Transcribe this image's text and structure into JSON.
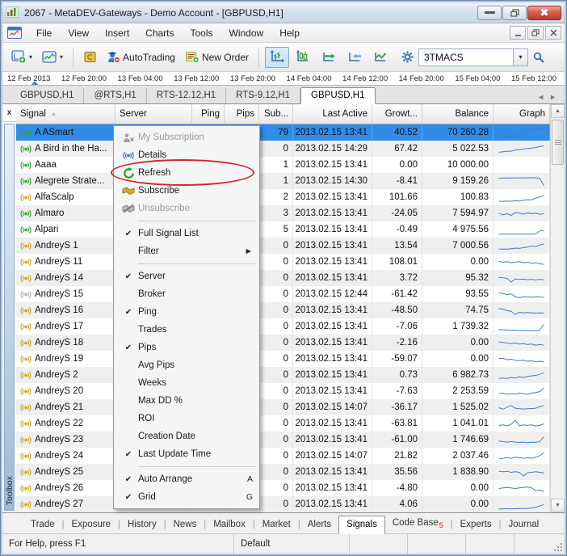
{
  "colors": {
    "selected_row": "#2f8ce8",
    "sparkline": "#3a7dc9",
    "annotation": "#d0262c",
    "signal_green": "#2da52d",
    "signal_yellow": "#d4a800",
    "signal_gray": "#b0b0b0"
  },
  "window": {
    "title": "2067 - MetaDEV-Gateways - Demo Account - [GBPUSD,H1]"
  },
  "menu_bar": {
    "items": [
      "File",
      "View",
      "Insert",
      "Charts",
      "Tools",
      "Window",
      "Help"
    ]
  },
  "toolbar": {
    "autotrading_label": "AutoTrading",
    "new_order_label": "New Order",
    "symbol_box_value": "3TMACS"
  },
  "timeline": {
    "labels": [
      "12 Feb 2013",
      "12 Feb 20:00",
      "13 Feb 04:00",
      "13 Feb 12:00",
      "13 Feb 20:00",
      "14 Feb 04:00",
      "14 Feb 12:00",
      "14 Feb 20:00",
      "15 Feb 04:00",
      "15 Feb 12:00"
    ]
  },
  "chart_tabs": {
    "tabs": [
      {
        "label": "GBPUSD,H1",
        "active": false
      },
      {
        "label": "@RTS,H1",
        "active": false
      },
      {
        "label": "RTS-12.12,H1",
        "active": false
      },
      {
        "label": "RTS-9.12,H1",
        "active": false
      },
      {
        "label": "GBPUSD,H1",
        "active": true
      }
    ]
  },
  "signals_table": {
    "columns": [
      {
        "key": "signal",
        "label": "Signal",
        "align": "left",
        "sorted": true
      },
      {
        "key": "server",
        "label": "Server",
        "align": "left"
      },
      {
        "key": "ping",
        "label": "Ping",
        "align": "right"
      },
      {
        "key": "pips",
        "label": "Pips",
        "align": "right"
      },
      {
        "key": "sub",
        "label": "Sub...",
        "align": "right"
      },
      {
        "key": "last_active",
        "label": "Last Active",
        "align": "right"
      },
      {
        "key": "growth",
        "label": "Growt...",
        "align": "right"
      },
      {
        "key": "balance",
        "label": "Balance",
        "align": "right"
      },
      {
        "key": "graph",
        "label": "Graph",
        "align": "right"
      }
    ],
    "selected_index": 0,
    "rows": [
      {
        "signal": "A ASmart",
        "icon": "green",
        "sub": "79",
        "last_active": "2013.02.15 13:41",
        "growth": "40.52",
        "balance": "70 260.28",
        "spark": [
          0.1,
          0.1,
          0.12,
          0.15,
          0.2,
          0.3,
          0.45,
          0.6,
          0.75,
          0.85,
          0.9,
          0.92
        ]
      },
      {
        "signal": "A Bird in the Ha...",
        "icon": "green",
        "sub": "0",
        "last_active": "2013.02.15 14:29",
        "growth": "67.42",
        "balance": "5 022.53",
        "spark": [
          0.2,
          0.25,
          0.3,
          0.3,
          0.4,
          0.45,
          0.5,
          0.55,
          0.6,
          0.65,
          0.75,
          0.8
        ]
      },
      {
        "signal": "Aaaa",
        "icon": "green",
        "sub": "1",
        "last_active": "2013.02.15 13:41",
        "growth": "0.00",
        "balance": "10 000.00",
        "spark": null
      },
      {
        "signal": "Alegrete Strate...",
        "icon": "green",
        "sub": "1",
        "last_active": "2013.02.15 14:30",
        "growth": "-8.41",
        "balance": "9 159.26",
        "spark": [
          0.8,
          0.82,
          0.82,
          0.83,
          0.83,
          0.84,
          0.84,
          0.85,
          0.85,
          0.85,
          0.8,
          0.1
        ]
      },
      {
        "signal": "AlfaScalp",
        "icon": "yellow",
        "sub": "2",
        "last_active": "2013.02.15 13:41",
        "growth": "101.66",
        "balance": "100.83",
        "spark": [
          0.15,
          0.15,
          0.18,
          0.15,
          0.2,
          0.18,
          0.25,
          0.3,
          0.28,
          0.45,
          0.55,
          0.7
        ]
      },
      {
        "signal": "Almaro",
        "icon": "green",
        "sub": "3",
        "last_active": "2013.02.15 13:41",
        "growth": "-24.05",
        "balance": "7 594.97",
        "spark": [
          0.55,
          0.4,
          0.5,
          0.35,
          0.6,
          0.55,
          0.45,
          0.6,
          0.5,
          0.55,
          0.45,
          0.5
        ]
      },
      {
        "signal": "Alpari",
        "icon": "green",
        "sub": "5",
        "last_active": "2013.02.15 13:41",
        "growth": "-0.49",
        "balance": "4 975.56",
        "spark": [
          0.1,
          0.1,
          0.1,
          0.1,
          0.1,
          0.1,
          0.1,
          0.1,
          0.1,
          0.12,
          0.4,
          0.45
        ]
      },
      {
        "signal": "AndreyS 1",
        "icon": "yellow",
        "sub": "0",
        "last_active": "2013.02.15 13:41",
        "growth": "13.54",
        "balance": "7 000.56",
        "spark": [
          0.2,
          0.22,
          0.2,
          0.25,
          0.3,
          0.28,
          0.35,
          0.4,
          0.5,
          0.45,
          0.6,
          0.7
        ]
      },
      {
        "signal": "AndreyS 11",
        "icon": "yellow",
        "sub": "0",
        "last_active": "2013.02.15 13:41",
        "growth": "108.01",
        "balance": "0.00",
        "spark": [
          0.6,
          0.5,
          0.55,
          0.45,
          0.5,
          0.55,
          0.45,
          0.5,
          0.4,
          0.45,
          0.35,
          0.3
        ]
      },
      {
        "signal": "AndreyS 14",
        "icon": "yellow",
        "sub": "0",
        "last_active": "2013.02.15 13:41",
        "growth": "3.72",
        "balance": "95.32",
        "spark": [
          0.6,
          0.55,
          0.5,
          0.15,
          0.45,
          0.4,
          0.42,
          0.38,
          0.4,
          0.35,
          0.4,
          0.38
        ]
      },
      {
        "signal": "AndreyS 15",
        "icon": "gray",
        "sub": "0",
        "last_active": "2013.02.15 12:44",
        "growth": "-61.42",
        "balance": "93.55",
        "spark": [
          0.7,
          0.6,
          0.5,
          0.55,
          0.3,
          0.2,
          0.3,
          0.28,
          0.25,
          0.3,
          0.28,
          0.25
        ]
      },
      {
        "signal": "AndreyS 16",
        "icon": "yellow",
        "sub": "0",
        "last_active": "2013.02.15 13:41",
        "growth": "-48.50",
        "balance": "74.75",
        "spark": [
          0.7,
          0.65,
          0.5,
          0.45,
          0.15,
          0.35,
          0.3,
          0.32,
          0.3,
          0.28,
          0.3,
          0.28
        ]
      },
      {
        "signal": "AndreyS 17",
        "icon": "yellow",
        "sub": "0",
        "last_active": "2013.02.15 13:41",
        "growth": "-7.06",
        "balance": "1 739.32",
        "spark": [
          0.25,
          0.22,
          0.2,
          0.18,
          0.2,
          0.15,
          0.18,
          0.15,
          0.12,
          0.15,
          0.2,
          0.75
        ]
      },
      {
        "signal": "AndreyS 18",
        "icon": "yellow",
        "sub": "0",
        "last_active": "2013.02.15 13:41",
        "growth": "-2.16",
        "balance": "0.00",
        "spark": [
          0.6,
          0.55,
          0.5,
          0.45,
          0.5,
          0.4,
          0.45,
          0.35,
          0.4,
          0.3,
          0.35,
          0.3
        ]
      },
      {
        "signal": "AndreyS 19",
        "icon": "yellow",
        "sub": "0",
        "last_active": "2013.02.15 13:41",
        "growth": "-59.07",
        "balance": "0.00",
        "spark": [
          0.55,
          0.6,
          0.45,
          0.5,
          0.4,
          0.35,
          0.4,
          0.3,
          0.35,
          0.25,
          0.3,
          0.25
        ]
      },
      {
        "signal": "AndreyS 2",
        "icon": "yellow",
        "sub": "0",
        "last_active": "2013.02.15 13:41",
        "growth": "0.73",
        "balance": "6 982.73",
        "spark": [
          0.2,
          0.25,
          0.2,
          0.3,
          0.25,
          0.35,
          0.3,
          0.4,
          0.45,
          0.5,
          0.6,
          0.75
        ]
      },
      {
        "signal": "AndreyS 20",
        "icon": "yellow",
        "sub": "0",
        "last_active": "2013.02.15 13:41",
        "growth": "-7.63",
        "balance": "2 253.59",
        "spark": [
          0.3,
          0.35,
          0.25,
          0.3,
          0.25,
          0.35,
          0.3,
          0.25,
          0.35,
          0.4,
          0.5,
          0.85
        ]
      },
      {
        "signal": "AndreyS 21",
        "icon": "yellow",
        "sub": "0",
        "last_active": "2013.02.15 14:07",
        "growth": "-36.17",
        "balance": "1 525.02",
        "spark": [
          0.5,
          0.35,
          0.55,
          0.7,
          0.45,
          0.4,
          0.38,
          0.4,
          0.42,
          0.45,
          0.6,
          0.7
        ]
      },
      {
        "signal": "AndreyS 22",
        "icon": "yellow",
        "sub": "0",
        "last_active": "2013.02.15 13:41",
        "growth": "-63.81",
        "balance": "1 041.01",
        "spark": [
          0.35,
          0.4,
          0.3,
          0.45,
          0.85,
          0.3,
          0.4,
          0.35,
          0.4,
          0.3,
          0.35,
          0.5
        ]
      },
      {
        "signal": "AndreyS 23",
        "icon": "yellow",
        "sub": "0",
        "last_active": "2013.02.15 13:41",
        "growth": "-61.00",
        "balance": "1 746.69",
        "spark": [
          0.4,
          0.35,
          0.3,
          0.35,
          0.3,
          0.28,
          0.3,
          0.25,
          0.3,
          0.28,
          0.35,
          0.8
        ]
      },
      {
        "signal": "AndreyS 24",
        "icon": "yellow",
        "sub": "0",
        "last_active": "2013.02.15 14:07",
        "growth": "21.82",
        "balance": "2 037.46",
        "spark": [
          0.25,
          0.3,
          0.35,
          0.3,
          0.4,
          0.35,
          0.3,
          0.35,
          0.3,
          0.4,
          0.55,
          0.8
        ]
      },
      {
        "signal": "AndreyS 25",
        "icon": "yellow",
        "sub": "0",
        "last_active": "2013.02.15 13:41",
        "growth": "35.56",
        "balance": "1 838.90",
        "spark": [
          0.6,
          0.55,
          0.6,
          0.5,
          0.55,
          0.5,
          0.15,
          0.45,
          0.5,
          0.55,
          0.5,
          0.45
        ]
      },
      {
        "signal": "AndreyS 26",
        "icon": "yellow",
        "sub": "0",
        "last_active": "2013.02.15 13:41",
        "growth": "-4.80",
        "balance": "0.00",
        "spark": [
          0.5,
          0.55,
          0.6,
          0.55,
          0.5,
          0.55,
          0.6,
          0.65,
          0.55,
          0.3,
          0.35,
          0.2
        ]
      },
      {
        "signal": "AndreyS 27",
        "icon": "yellow",
        "sub": "0",
        "last_active": "2013.02.15 13:41",
        "growth": "4.06",
        "balance": "0.00",
        "spark": [
          0.1,
          0.1,
          0.12,
          0.1,
          0.12,
          0.15,
          0.12,
          0.15,
          0.18,
          0.25,
          0.4,
          0.5
        ]
      }
    ]
  },
  "context_menu": {
    "items": [
      {
        "label": "My Subscription",
        "icon": "subscription-icon",
        "disabled": true
      },
      {
        "label": "Details",
        "icon": "details-icon"
      },
      {
        "label": "Refresh",
        "icon": "refresh-icon",
        "annotated": true
      },
      {
        "label": "Subscribe",
        "icon": "subscribe-icon"
      },
      {
        "label": "Unsubscribe",
        "icon": "unsubscribe-icon",
        "disabled": true
      },
      {
        "separator": true
      },
      {
        "label": "Full Signal List",
        "checked": true
      },
      {
        "label": "Filter",
        "submenu": true
      },
      {
        "separator": true
      },
      {
        "label": "Server",
        "checked": true
      },
      {
        "label": "Broker"
      },
      {
        "label": "Ping",
        "checked": true
      },
      {
        "label": "Trades"
      },
      {
        "label": "Pips",
        "checked": true
      },
      {
        "label": "Avg Pips"
      },
      {
        "label": "Weeks"
      },
      {
        "label": "Max DD %"
      },
      {
        "label": "ROI"
      },
      {
        "label": "Creation Date"
      },
      {
        "label": "Last Update Time",
        "checked": true
      },
      {
        "separator": true
      },
      {
        "label": "Auto Arrange",
        "checked": true,
        "shortcut": "A"
      },
      {
        "label": "Grid",
        "checked": true,
        "shortcut": "G"
      }
    ]
  },
  "toolbox": {
    "panel_label": "Toolbox",
    "tabs": [
      {
        "label": "Trade"
      },
      {
        "label": "Exposure"
      },
      {
        "label": "History"
      },
      {
        "label": "News"
      },
      {
        "label": "Mailbox"
      },
      {
        "label": "Market"
      },
      {
        "label": "Alerts"
      },
      {
        "label": "Signals",
        "active": true
      },
      {
        "label": "Code Base",
        "badge": "5"
      },
      {
        "label": "Experts"
      },
      {
        "label": "Journal"
      }
    ]
  },
  "status_bar": {
    "help_text": "For Help, press F1",
    "profile": "Default"
  }
}
